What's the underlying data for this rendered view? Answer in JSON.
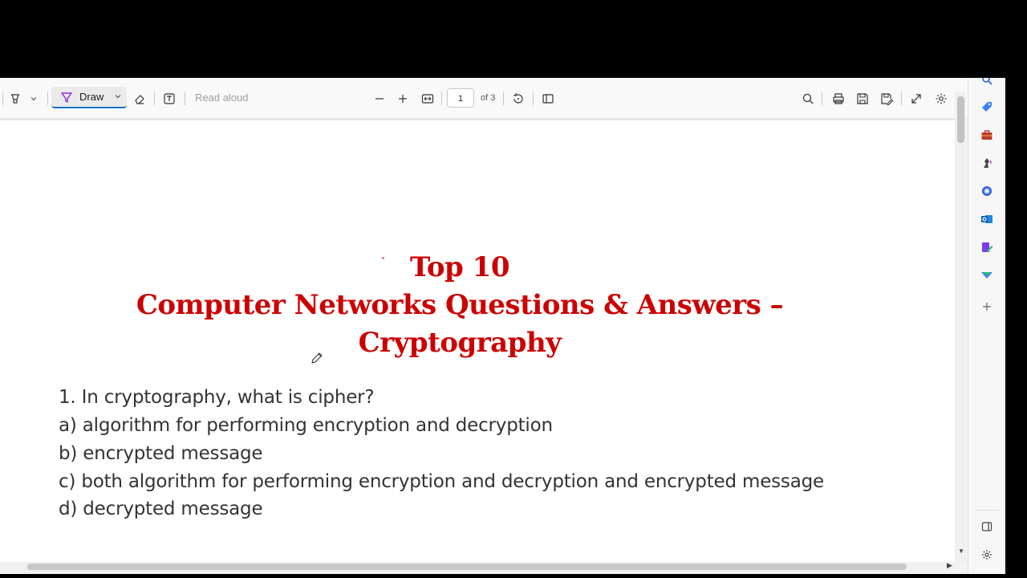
{
  "toolbar": {
    "draw_label": "Draw",
    "read_aloud_label": "Read aloud",
    "page_current": "1",
    "page_total": "of 3"
  },
  "document": {
    "title_line1": "Top 10",
    "title_line2": "Computer Networks Questions & Answers –",
    "title_line3": "Cryptography",
    "question": "1. In cryptography, what is cipher?",
    "options": [
      "a) algorithm for performing encryption and decryption",
      "b) encrypted message",
      "c) both algorithm for performing encryption and decryption and encrypted message",
      "d) decrypted message"
    ]
  },
  "colors": {
    "title": "#cc0000",
    "body_text": "#333333",
    "accent": "#1a73c9"
  },
  "icons": {
    "toolbar": [
      "highlight-icon",
      "chevron-down-icon",
      "draw-icon",
      "eraser-icon",
      "text-box-icon",
      "zoom-out-icon",
      "zoom-in-icon",
      "fit-width-icon",
      "rotate-icon",
      "page-view-icon",
      "search-icon",
      "print-icon",
      "save-icon",
      "save-as-icon",
      "fullscreen-icon",
      "settings-icon"
    ],
    "sidebar": [
      "search-icon",
      "tag-icon",
      "briefcase-icon",
      "games-icon",
      "copilot-icon",
      "outlook-icon",
      "pen-icon",
      "drop-icon",
      "add-icon",
      "sidebar-toggle-icon",
      "settings-icon"
    ]
  }
}
